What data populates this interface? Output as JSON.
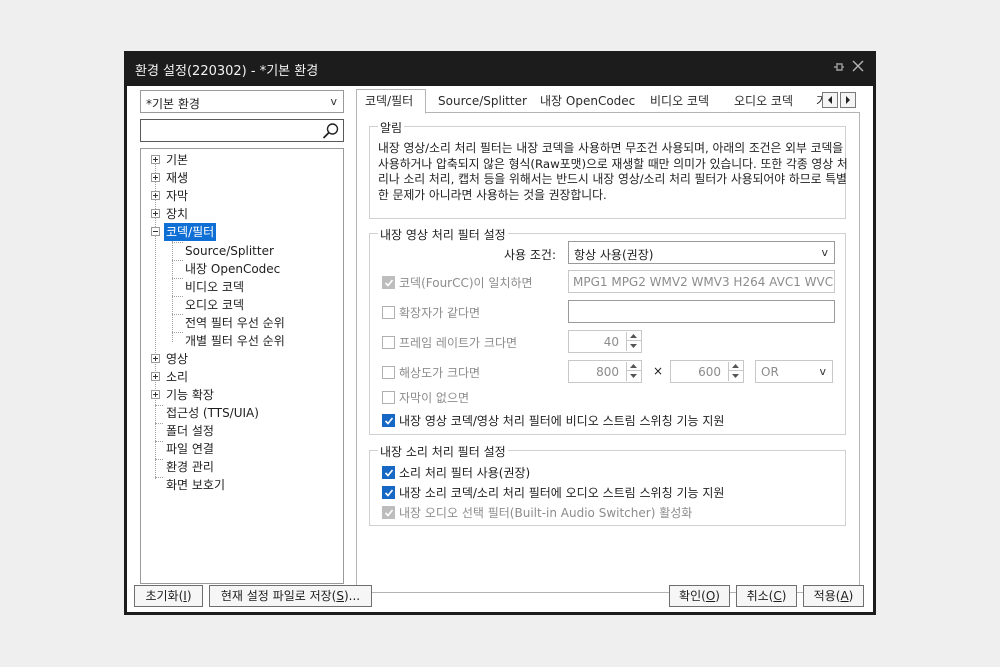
{
  "window": {
    "title": "환경 설정(220302) - *기본 환경"
  },
  "left": {
    "profile_value": "*기본 환경",
    "search_value": "",
    "tree": {
      "basic": "기본",
      "playback": "재생",
      "subtitle": "자막",
      "device": "장치",
      "codec_filter": "코덱/필터",
      "source_splitter": "Source/Splitter",
      "internal_opencodec": "내장 OpenCodec",
      "video_codec": "비디오 코덱",
      "audio_codec": "오디오 코덱",
      "global_filter_priority": "전역 필터 우선 순위",
      "individual_filter_priority": "개별 필터 우선 순위",
      "video": "영상",
      "sound": "소리",
      "extensions": "기능 확장",
      "accessibility": "접근성 (TTS/UIA)",
      "folder_settings": "폴더 설정",
      "file_association": "파일 연결",
      "profile_management": "환경 관리",
      "screensaver": "화면 보호기"
    }
  },
  "tabs": [
    "코덱/필터",
    "Source/Splitter",
    "내장 OpenCodec",
    "비디오 코덱",
    "오디오 코덱",
    "기"
  ],
  "notice": {
    "legend": "알림",
    "text": "내장 영상/소리 처리 필터는 내장 코덱을 사용하면 무조건 사용되며, 아래의 조건은 외부 코덱을 사용하거나 압축되지 않은 형식(Raw포맷)으로 재생할 때만 의미가 있습니다. 또한 각종 영상 처리나 소리 처리, 캡처 등을 위해서는 반드시 내장 영상/소리 처리 필터가 사용되어야 하므로 특별한 문제가 아니라면 사용하는 것을 권장합니다."
  },
  "video_filter": {
    "legend": "내장 영상 처리 필터 설정",
    "use_condition_label": "사용 조건:",
    "use_condition_value": "항상 사용(권장)",
    "fourcc_label": "코덱(FourCC)이 일치하면",
    "fourcc_value": "MPG1 MPG2 WMV2 WMV3 H264 AVC1 WVC1",
    "extension_label": "확장자가 같다면",
    "extension_value": "",
    "framerate_label": "프레임 레이트가 크다면",
    "framerate_value": "40",
    "resolution_label": "해상도가 크다면",
    "width_value": "800",
    "times": "×",
    "height_value": "600",
    "logic_value": "OR",
    "no_subtitle_label": "자막이 없으면",
    "stream_switch_label": "내장 영상 코덱/영상 처리 필터에 비디오 스트림 스위칭 기능 지원"
  },
  "audio_filter": {
    "legend": "내장 소리 처리 필터 설정",
    "use_label": "소리 처리 필터 사용(권장)",
    "stream_switch_label": "내장 소리 코덱/소리 처리 필터에 오디오 스트림 스위칭 기능 지원",
    "builtin_switcher_label": "내장 오디오 선택 필터(Built-in Audio Switcher) 활성화"
  },
  "buttons": {
    "reset_text": "초기화",
    "reset_key": "I",
    "save_text": "현재 설정 파일로 저장",
    "save_key": "S",
    "save_suffix": "...",
    "ok_text": "확인",
    "ok_key": "O",
    "cancel_text": "취소",
    "cancel_key": "C",
    "apply_text": "적용",
    "apply_key": "A",
    "open_paren": "(",
    "close_paren": ")"
  },
  "colors": {
    "accent": "#1768c4",
    "selection": "#0f6fd4",
    "titlebar": "#1c1c1c"
  }
}
